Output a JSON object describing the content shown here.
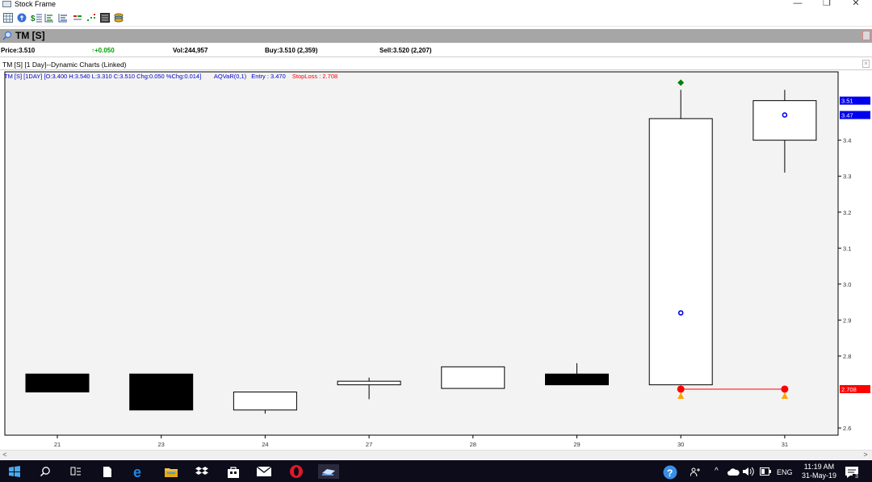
{
  "window": {
    "title": "Stock Frame",
    "minimize_glyph": "—",
    "restore_glyph": "❐",
    "close_glyph": "✕"
  },
  "toolbar": {
    "icons": [
      "grid-icon",
      "info-icon",
      "price-table-icon",
      "level-icon",
      "bars-icon",
      "mixed-bars-icon",
      "dots-icon",
      "board-icon",
      "layers-icon"
    ]
  },
  "symbol_bar": {
    "symbol": "TM [S]"
  },
  "quote": {
    "price": "Price:3.510",
    "change": "+0.050",
    "volume": "Vol:244,957",
    "buy": "Buy:3.510 (2,359)",
    "sell": "Sell:3.520 (2,207)",
    "change_color": "#00a000"
  },
  "chart_window": {
    "title": "TM [S] [1 Day]--Dynamic Charts (Linked)",
    "close_glyph": "×"
  },
  "chart_info": {
    "ohlc_text": "TM [S] [1DAY] [O:3.400 H:3.540 L:3.310 C:3.510 Chg:0.050 %Chg:0.014]",
    "indicator": "AQVaR(0,1)",
    "entry": "Entry : 3.470",
    "stoploss": "StopLoss : 2.708",
    "colors": {
      "ohlc": "#0000cc",
      "indicator": "#0000cc",
      "entry": "#0000cc",
      "stoploss": "#ff0000"
    }
  },
  "chart_data": {
    "type": "candlestick",
    "categories": [
      "21",
      "23",
      "24",
      "27",
      "28",
      "29",
      "30",
      "31"
    ],
    "candles": [
      {
        "x": "21",
        "open": 2.75,
        "high": 2.75,
        "low": 2.7,
        "close": 2.7
      },
      {
        "x": "23",
        "open": 2.75,
        "high": 2.75,
        "low": 2.65,
        "close": 2.65
      },
      {
        "x": "24",
        "open": 2.65,
        "high": 2.7,
        "low": 2.64,
        "close": 2.7
      },
      {
        "x": "27",
        "open": 2.72,
        "high": 2.74,
        "low": 2.68,
        "close": 2.73
      },
      {
        "x": "28",
        "open": 2.71,
        "high": 2.77,
        "low": 2.71,
        "close": 2.77
      },
      {
        "x": "29",
        "open": 2.75,
        "high": 2.78,
        "low": 2.72,
        "close": 2.72
      },
      {
        "x": "30",
        "open": 2.72,
        "high": 3.54,
        "low": 2.72,
        "close": 3.46
      },
      {
        "x": "31",
        "open": 3.4,
        "high": 3.54,
        "low": 3.31,
        "close": 3.51
      }
    ],
    "blue_markers": [
      {
        "x": "30",
        "y": 2.92
      },
      {
        "x": "31",
        "y": 3.47
      }
    ],
    "green_marker": {
      "x": "30",
      "y": 3.56
    },
    "red_markers": [
      {
        "x": "30",
        "y": 2.708
      },
      {
        "x": "31",
        "y": 2.708
      }
    ],
    "orange_markers": [
      {
        "x": "30",
        "y": 2.69
      },
      {
        "x": "31",
        "y": 2.69
      }
    ],
    "stoploss_line": {
      "from": "30",
      "to": "31",
      "y": 2.708
    },
    "yticks": [
      "3.4",
      "3.3",
      "3.2",
      "3.1",
      "3.0",
      "2.9",
      "2.8",
      "2.6"
    ],
    "ylim": [
      2.58,
      3.59
    ],
    "price_labels": [
      {
        "value": "3.51",
        "y": 3.51,
        "bg": "#0000ee",
        "fg": "#ffffff"
      },
      {
        "value": "3.47",
        "y": 3.47,
        "bg": "#0000ee",
        "fg": "#ffffff"
      },
      {
        "value": "2.708",
        "y": 2.708,
        "bg": "#ff0000",
        "fg": "#ffffff"
      }
    ],
    "colors": {
      "bear": "#000000",
      "bull": "#ffffff",
      "outline": "#000000",
      "blue": "#0000ee",
      "green": "#008000",
      "red": "#ff0000",
      "orange": "#ffa500",
      "stopline": "#ff0000",
      "bg": "#f3f3f3"
    }
  },
  "scrollbar": {
    "left_glyph": "<",
    "right_glyph": ">"
  },
  "taskbar": {
    "items": [
      "windows-start-icon",
      "search-icon",
      "task-view-icon",
      "file-icon",
      "edge-icon",
      "file-explorer-icon",
      "dropbox-icon",
      "store-icon",
      "mail-icon",
      "opera-icon",
      "stock-app-icon"
    ],
    "tray_lang": "ENG",
    "time": "11:19 AM",
    "date": "31-May-19",
    "notif_count": "3"
  }
}
